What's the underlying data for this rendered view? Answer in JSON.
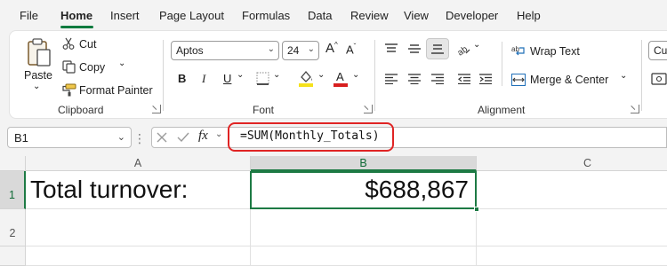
{
  "menu": {
    "items": [
      "File",
      "Home",
      "Insert",
      "Page Layout",
      "Formulas",
      "Data",
      "Review",
      "View",
      "Developer",
      "Help"
    ],
    "active": "Home"
  },
  "ribbon": {
    "clipboard": {
      "paste_label": "Paste",
      "cut_label": "Cut",
      "copy_label": "Copy",
      "format_painter_label": "Format Painter",
      "group_label": "Clipboard"
    },
    "font": {
      "font_name": "Aptos",
      "font_size": "24",
      "bold": "B",
      "italic": "I",
      "underline": "U",
      "group_label": "Font",
      "fill_color": "#f5e11c",
      "font_color": "#d81f1f"
    },
    "alignment": {
      "wrap_text_label": "Wrap Text",
      "merge_label": "Merge & Center",
      "group_label": "Alignment"
    },
    "number": {
      "format_partial": "Cur"
    }
  },
  "formula_bar": {
    "name_box": "B1",
    "fx": "fx",
    "formula": "=SUM(Monthly_Totals)",
    "highlight_color": "#e02424"
  },
  "sheet": {
    "columns": [
      "A",
      "B",
      "C"
    ],
    "rows": [
      "1",
      "2"
    ],
    "selected_column": "B",
    "selected_row": "1",
    "cells": {
      "A1": "Total turnover:",
      "B1": "$688,867"
    },
    "accent_color": "#1d7a44"
  }
}
